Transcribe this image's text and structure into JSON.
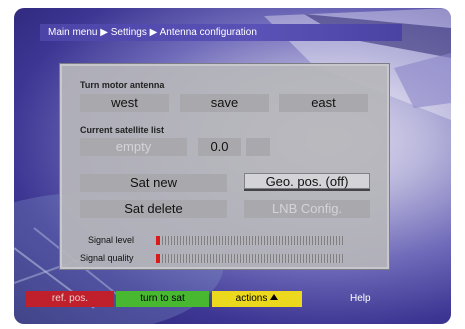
{
  "breadcrumb": {
    "parts": [
      "Main menu",
      "Settings",
      "Antenna configuration"
    ],
    "separator": "▶"
  },
  "motor": {
    "label": "Turn motor antenna",
    "west": "west",
    "save": "save",
    "east": "east"
  },
  "satlist": {
    "label": "Current satellite list",
    "name": "empty",
    "position": "0.0",
    "extra": ""
  },
  "actions": {
    "sat_new": "Sat new",
    "geo_pos": "Geo. pos. (off)",
    "sat_delete": "Sat delete",
    "lnb_config": "LNB Config."
  },
  "signal": {
    "level_label": "Signal level",
    "quality_label": "Signal quality",
    "level": 0.02,
    "quality": 0.02,
    "bar_color": "#d81a1a"
  },
  "function_keys": {
    "red": {
      "label": "ref. pos.",
      "color": "#c0202c"
    },
    "green": {
      "label": "turn to sat",
      "color": "#48b830"
    },
    "yellow": {
      "label": "actions",
      "color": "#ecd81c",
      "icon": "triangle-up-icon"
    },
    "help": "Help"
  }
}
